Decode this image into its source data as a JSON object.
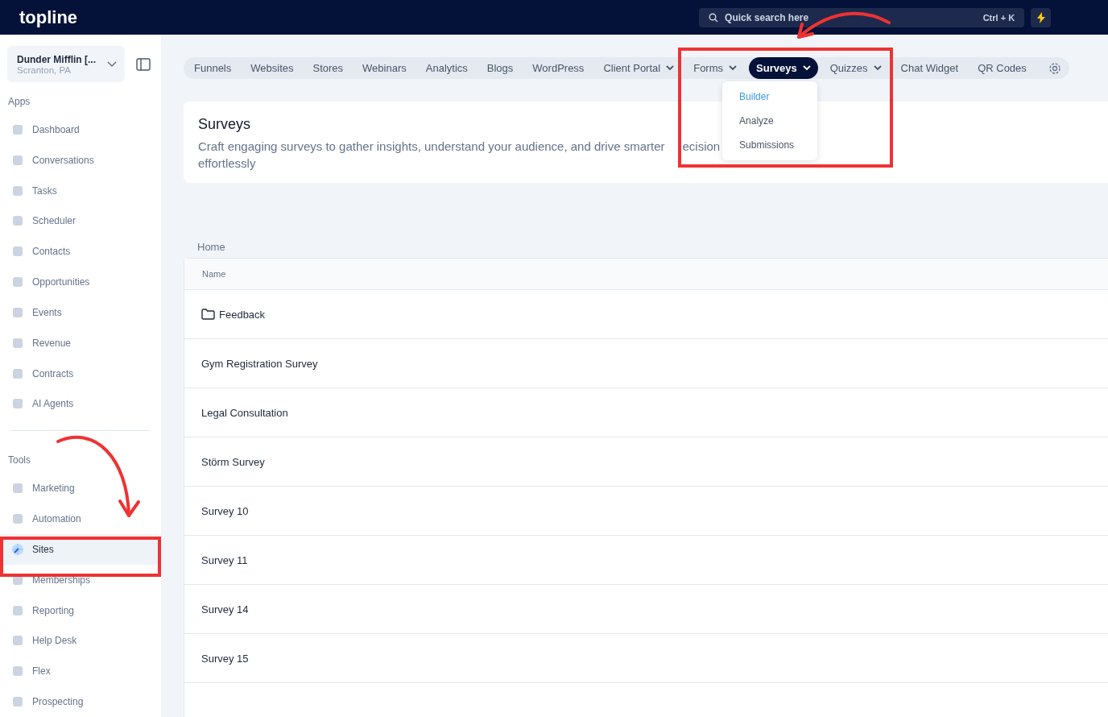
{
  "topbar": {
    "logo": "topline",
    "search": {
      "placeholder": "Quick search here",
      "shortcut": "Ctrl + K"
    }
  },
  "account": {
    "name": "Dunder Mifflin [...",
    "location": "Scranton, PA"
  },
  "sidebar": {
    "sections": [
      {
        "title": "Apps",
        "items": [
          {
            "label": "Dashboard",
            "selected": false
          },
          {
            "label": "Conversations",
            "selected": false
          },
          {
            "label": "Tasks",
            "selected": false
          },
          {
            "label": "Scheduler",
            "selected": false
          },
          {
            "label": "Contacts",
            "selected": false
          },
          {
            "label": "Opportunities",
            "selected": false
          },
          {
            "label": "Events",
            "selected": false
          },
          {
            "label": "Revenue",
            "selected": false
          },
          {
            "label": "Contracts",
            "selected": false
          },
          {
            "label": "AI Agents",
            "selected": false
          }
        ]
      },
      {
        "title": "Tools",
        "items": [
          {
            "label": "Marketing",
            "selected": false
          },
          {
            "label": "Automation",
            "selected": false
          },
          {
            "label": "Sites",
            "selected": true
          },
          {
            "label": "Memberships",
            "selected": false
          },
          {
            "label": "Reporting",
            "selected": false
          },
          {
            "label": "Help Desk",
            "selected": false
          },
          {
            "label": "Flex",
            "selected": false
          },
          {
            "label": "Prospecting",
            "selected": false
          }
        ]
      }
    ]
  },
  "tabs": [
    {
      "label": "Funnels",
      "selected": false,
      "dropdown": false
    },
    {
      "label": "Websites",
      "selected": false,
      "dropdown": false
    },
    {
      "label": "Stores",
      "selected": false,
      "dropdown": false
    },
    {
      "label": "Webinars",
      "selected": false,
      "dropdown": false
    },
    {
      "label": "Analytics",
      "selected": false,
      "dropdown": false
    },
    {
      "label": "Blogs",
      "selected": false,
      "dropdown": false
    },
    {
      "label": "WordPress",
      "selected": false,
      "dropdown": false
    },
    {
      "label": "Client Portal",
      "selected": false,
      "dropdown": true
    },
    {
      "label": "Forms",
      "selected": false,
      "dropdown": true
    },
    {
      "label": "Surveys",
      "selected": true,
      "dropdown": true
    },
    {
      "label": "Quizzes",
      "selected": false,
      "dropdown": true
    },
    {
      "label": "Chat Widget",
      "selected": false,
      "dropdown": false
    },
    {
      "label": "QR Codes",
      "selected": false,
      "dropdown": false
    }
  ],
  "dropdown_menu": [
    {
      "label": "Builder",
      "selected": true
    },
    {
      "label": "Analyze",
      "selected": false
    },
    {
      "label": "Submissions",
      "selected": false
    }
  ],
  "header": {
    "title": "Surveys",
    "description": "Craft engaging surveys to gather insights, understand your audience, and drive smarter",
    "covered_word_fragment": "ecision",
    "description_end": "effortlessly"
  },
  "breadcrumb": "Home",
  "table": {
    "columns": [
      "Name"
    ],
    "rows": [
      {
        "name": "Feedback",
        "kind": "folder"
      },
      {
        "name": "Gym Registration Survey",
        "kind": "survey"
      },
      {
        "name": "Legal Consultation",
        "kind": "survey"
      },
      {
        "name": "Störm Survey",
        "kind": "survey"
      },
      {
        "name": "Survey 10",
        "kind": "survey"
      },
      {
        "name": "Survey 11",
        "kind": "survey"
      },
      {
        "name": "Survey 14",
        "kind": "survey"
      },
      {
        "name": "Survey 15",
        "kind": "survey"
      }
    ]
  }
}
